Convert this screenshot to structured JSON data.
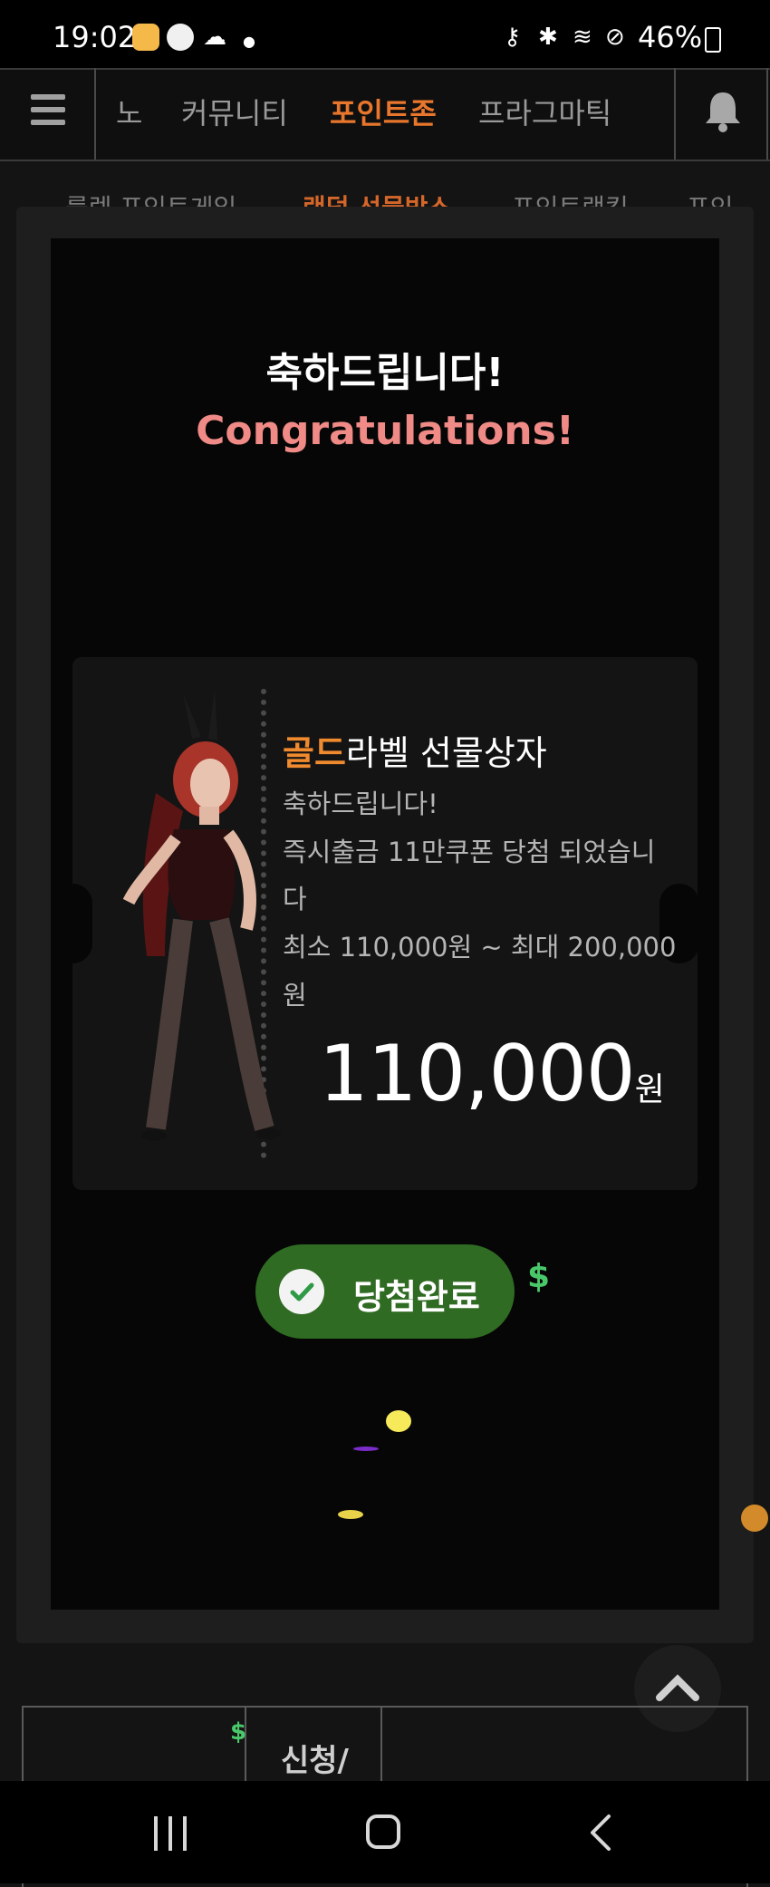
{
  "status_bar": {
    "time": "19:02",
    "battery": "46%",
    "icons": [
      "kakao-icon",
      "talk-icon",
      "weather-icon",
      "key-icon",
      "bluetooth-icon",
      "wifi-icon",
      "mute-icon",
      "battery-icon"
    ]
  },
  "top_nav": {
    "menu_icon": "menu-icon",
    "items": [
      "노",
      "커뮤니티",
      "포인트존",
      "프라그마틱"
    ],
    "active_index": 2,
    "bell_icon": "bell-icon"
  },
  "sub_tabs": {
    "items": [
      "룰렛 포인트게임",
      "랜덤 선물박스",
      "포인트랭킹",
      "포인"
    ],
    "active_index": 1
  },
  "modal": {
    "title_ko": "축하드립니다!",
    "title_en": "Congratulations!",
    "prize": {
      "label_gold": "골드",
      "label_rest": "라벨 선물상자",
      "line1": "축하드립니다!",
      "line2": "즉시출금 11만쿠폰 당첨 되었습니",
      "line3": "다",
      "line4": "최소 110,000원 ~ 최대 200,000",
      "line5": "원",
      "amount": "110,000",
      "unit": "원"
    },
    "done_button": "당첨완료",
    "dollar_symbol": "$"
  },
  "bottom_table": {
    "cell_text": "신청/"
  },
  "colors": {
    "accent_orange": "#e8762c",
    "gold": "#f08a2e",
    "congrats_pink": "#ef8a86",
    "done_green": "#2f6b22",
    "dollar_green": "#49c86a"
  }
}
